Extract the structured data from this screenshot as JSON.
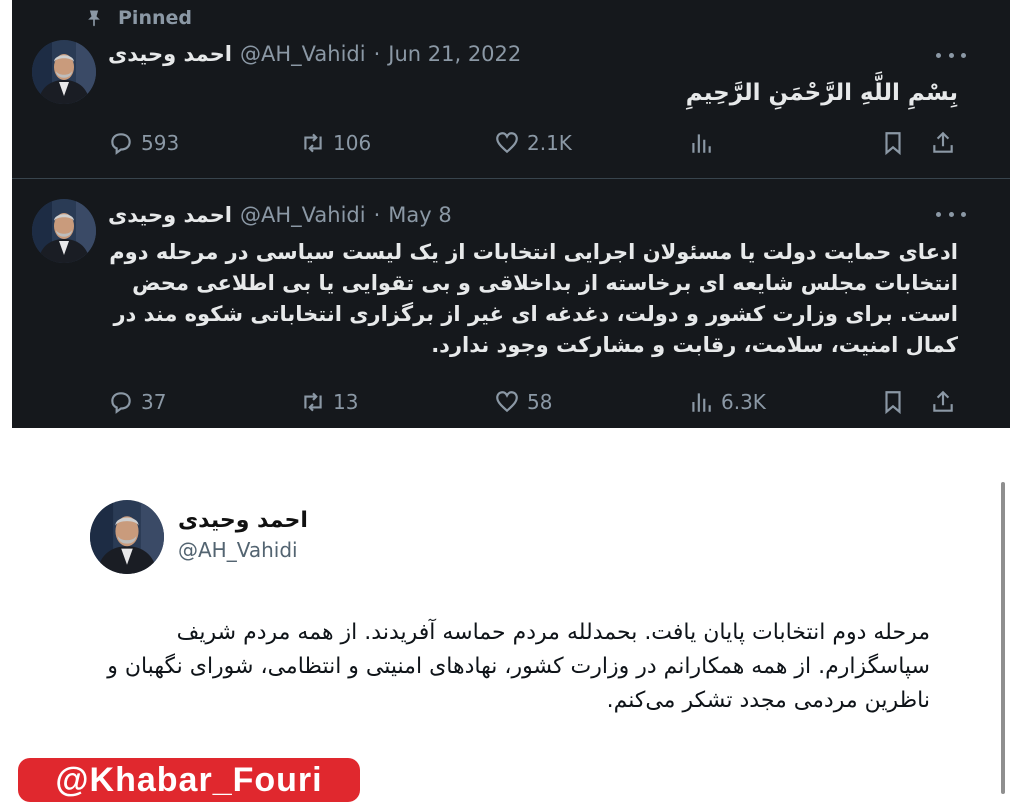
{
  "pinned_label": "Pinned",
  "tweets": [
    {
      "name": "احمد وحیدی",
      "handle": "@AH_Vahidi",
      "dot": "·",
      "date": "Jun 21, 2022",
      "text": "بِسْمِ اللَّهِ الرَّحْمَنِ الرَّحِيمِ",
      "replies": "593",
      "retweets": "106",
      "likes": "2.1K",
      "views": ""
    },
    {
      "name": "احمد وحیدی",
      "handle": "@AH_Vahidi",
      "dot": "·",
      "date": "May 8",
      "text": "ادعای حمایت دولت یا مسئولان اجرایی انتخابات از یک لیست سیاسی در مرحله دوم انتخابات مجلس شایعه ای برخاسته از بداخلاقی و بی تقوایی یا بی اطلاعی محض است. برای وزارت کشور و دولت، دغدغه ای غیر از برگزاری انتخاباتی شکوه مند در کمال امنیت، سلامت، رقابت و مشارکت وجود ندارد.",
      "replies": "37",
      "retweets": "13",
      "likes": "58",
      "views": "6.3K"
    }
  ],
  "card": {
    "name": "احمد وحیدی",
    "handle": "@AH_Vahidi",
    "text": "مرحله دوم انتخابات پایان یافت. بحمدلله مردم حماسه آفریدند. از همه مردم شریف سپاسگزارم. از همه همکارانم در وزارت کشور، نهادهای امنیتی و انتظامی، شورای نگهبان و ناظرین مردمی مجدد تشکر می‌کنم."
  },
  "watermark": "@Khabar_Fouri",
  "colors": {
    "dark_background": "#15181c",
    "muted_text": "#8b98a5",
    "watermark_red": "#e0282e"
  }
}
